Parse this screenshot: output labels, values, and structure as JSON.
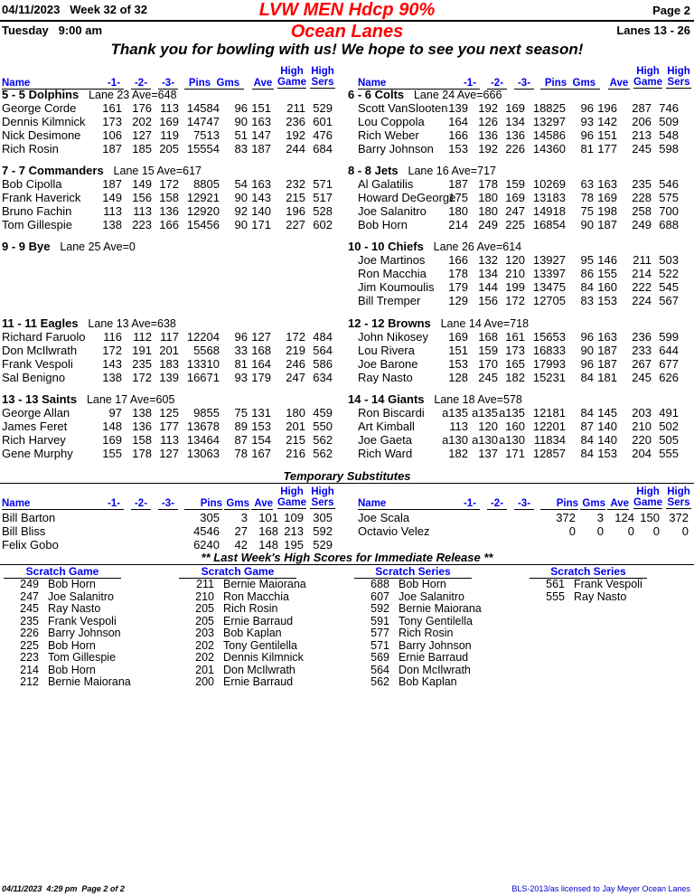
{
  "header": {
    "date": "04/11/2023",
    "week": "Week 32 of 32",
    "title": "LVW MEN Hdcp 90%",
    "page": "Page 2",
    "day_time": "Tuesday   9:00 am",
    "center": "Ocean Lanes",
    "lanes": "Lanes 13 - 26",
    "message": "Thank you for bowling with us! We hope to see you next season!"
  },
  "columns": {
    "name": "Name",
    "g1": "-1-",
    "g2": "-2-",
    "g3": "-3-",
    "pins": "Pins",
    "gms": "Gms",
    "ave": "Ave",
    "high_game_1": "High",
    "high_game_2": "Game",
    "high_sers_1": "High",
    "high_sers_2": "Sers"
  },
  "left_teams": [
    {
      "title": "5 - 5 Dolphins",
      "meta": "Lane 23  Ave=648",
      "players": [
        {
          "name": "George Corde",
          "g1": "161",
          "g2": "176",
          "g3": "113",
          "pins": "14584",
          "gms": "96",
          "ave": "151",
          "hg": "211",
          "hs": "529"
        },
        {
          "name": "Dennis Kilmnick",
          "g1": "173",
          "g2": "202",
          "g3": "169",
          "pins": "14747",
          "gms": "90",
          "ave": "163",
          "hg": "236",
          "hs": "601"
        },
        {
          "name": "Nick Desimone",
          "g1": "106",
          "g2": "127",
          "g3": "119",
          "pins": "7513",
          "gms": "51",
          "ave": "147",
          "hg": "192",
          "hs": "476"
        },
        {
          "name": "Rich Rosin",
          "g1": "187",
          "g2": "185",
          "g3": "205",
          "pins": "15554",
          "gms": "83",
          "ave": "187",
          "hg": "244",
          "hs": "684"
        }
      ]
    },
    {
      "title": "7 - 7 Commanders",
      "meta": "Lane 15  Ave=617",
      "players": [
        {
          "name": "Bob Cipolla",
          "g1": "187",
          "g2": "149",
          "g3": "172",
          "pins": "8805",
          "gms": "54",
          "ave": "163",
          "hg": "232",
          "hs": "571"
        },
        {
          "name": "Frank Haverick",
          "g1": "149",
          "g2": "156",
          "g3": "158",
          "pins": "12921",
          "gms": "90",
          "ave": "143",
          "hg": "215",
          "hs": "517"
        },
        {
          "name": "Bruno Fachin",
          "g1": "113",
          "g2": "113",
          "g3": "136",
          "pins": "12920",
          "gms": "92",
          "ave": "140",
          "hg": "196",
          "hs": "528"
        },
        {
          "name": "Tom Gillespie",
          "g1": "138",
          "g2": "223",
          "g3": "166",
          "pins": "15456",
          "gms": "90",
          "ave": "171",
          "hg": "227",
          "hs": "602"
        }
      ]
    },
    {
      "title": "9 - 9 Bye",
      "meta": "Lane 25  Ave=0",
      "players": []
    },
    {
      "title": "11 - 11 Eagles",
      "meta": "Lane 13  Ave=638",
      "players": [
        {
          "name": "Richard Faruolo",
          "g1": "116",
          "g2": "112",
          "g3": "117",
          "pins": "12204",
          "gms": "96",
          "ave": "127",
          "hg": "172",
          "hs": "484"
        },
        {
          "name": "Don McIlwrath",
          "g1": "172",
          "g2": "191",
          "g3": "201",
          "pins": "5568",
          "gms": "33",
          "ave": "168",
          "hg": "219",
          "hs": "564"
        },
        {
          "name": "Frank Vespoli",
          "g1": "143",
          "g2": "235",
          "g3": "183",
          "pins": "13310",
          "gms": "81",
          "ave": "164",
          "hg": "246",
          "hs": "586"
        },
        {
          "name": "Sal Benigno",
          "g1": "138",
          "g2": "172",
          "g3": "139",
          "pins": "16671",
          "gms": "93",
          "ave": "179",
          "hg": "247",
          "hs": "634"
        }
      ]
    },
    {
      "title": "13 - 13 Saints",
      "meta": "Lane 17  Ave=605",
      "players": [
        {
          "name": "George Allan",
          "g1": "97",
          "g2": "138",
          "g3": "125",
          "pins": "9855",
          "gms": "75",
          "ave": "131",
          "hg": "180",
          "hs": "459"
        },
        {
          "name": "James Feret",
          "g1": "148",
          "g2": "136",
          "g3": "177",
          "pins": "13678",
          "gms": "89",
          "ave": "153",
          "hg": "201",
          "hs": "550"
        },
        {
          "name": "Rich Harvey",
          "g1": "169",
          "g2": "158",
          "g3": "113",
          "pins": "13464",
          "gms": "87",
          "ave": "154",
          "hg": "215",
          "hs": "562"
        },
        {
          "name": "Gene Murphy",
          "g1": "155",
          "g2": "178",
          "g3": "127",
          "pins": "13063",
          "gms": "78",
          "ave": "167",
          "hg": "216",
          "hs": "562"
        }
      ]
    }
  ],
  "right_teams": [
    {
      "title": "6 - 6 Colts",
      "meta": "Lane 24  Ave=666",
      "players": [
        {
          "name": "Scott VanSlooten",
          "g1": "139",
          "g2": "192",
          "g3": "169",
          "pins": "18825",
          "gms": "96",
          "ave": "196",
          "hg": "287",
          "hs": "746"
        },
        {
          "name": "Lou Coppola",
          "g1": "164",
          "g2": "126",
          "g3": "134",
          "pins": "13297",
          "gms": "93",
          "ave": "142",
          "hg": "206",
          "hs": "509"
        },
        {
          "name": "Rich Weber",
          "g1": "166",
          "g2": "136",
          "g3": "136",
          "pins": "14586",
          "gms": "96",
          "ave": "151",
          "hg": "213",
          "hs": "548"
        },
        {
          "name": "Barry Johnson",
          "g1": "153",
          "g2": "192",
          "g3": "226",
          "pins": "14360",
          "gms": "81",
          "ave": "177",
          "hg": "245",
          "hs": "598"
        }
      ]
    },
    {
      "title": "8 - 8 Jets",
      "meta": "Lane 16  Ave=717",
      "players": [
        {
          "name": "Al Galatilis",
          "g1": "187",
          "g2": "178",
          "g3": "159",
          "pins": "10269",
          "gms": "63",
          "ave": "163",
          "hg": "235",
          "hs": "546"
        },
        {
          "name": "Howard DeGeorge",
          "g1": "175",
          "g2": "180",
          "g3": "169",
          "pins": "13183",
          "gms": "78",
          "ave": "169",
          "hg": "228",
          "hs": "575"
        },
        {
          "name": "Joe Salanitro",
          "g1": "180",
          "g2": "180",
          "g3": "247",
          "pins": "14918",
          "gms": "75",
          "ave": "198",
          "hg": "258",
          "hs": "700"
        },
        {
          "name": "Bob Horn",
          "g1": "214",
          "g2": "249",
          "g3": "225",
          "pins": "16854",
          "gms": "90",
          "ave": "187",
          "hg": "249",
          "hs": "688"
        }
      ]
    },
    {
      "title": "10 - 10 Chiefs",
      "meta": "Lane 26  Ave=614",
      "players": [
        {
          "name": "Joe Martinos",
          "g1": "166",
          "g2": "132",
          "g3": "120",
          "pins": "13927",
          "gms": "95",
          "ave": "146",
          "hg": "211",
          "hs": "503"
        },
        {
          "name": "Ron Macchia",
          "g1": "178",
          "g2": "134",
          "g3": "210",
          "pins": "13397",
          "gms": "86",
          "ave": "155",
          "hg": "214",
          "hs": "522"
        },
        {
          "name": "Jim Koumoulis",
          "g1": "179",
          "g2": "144",
          "g3": "199",
          "pins": "13475",
          "gms": "84",
          "ave": "160",
          "hg": "222",
          "hs": "545"
        },
        {
          "name": "Bill Tremper",
          "g1": "129",
          "g2": "156",
          "g3": "172",
          "pins": "12705",
          "gms": "83",
          "ave": "153",
          "hg": "224",
          "hs": "567"
        }
      ]
    },
    {
      "title": "12 - 12 Browns",
      "meta": "Lane 14  Ave=718",
      "players": [
        {
          "name": "John Nikosey",
          "g1": "169",
          "g2": "168",
          "g3": "161",
          "pins": "15653",
          "gms": "96",
          "ave": "163",
          "hg": "236",
          "hs": "599"
        },
        {
          "name": "Lou Rivera",
          "g1": "151",
          "g2": "159",
          "g3": "173",
          "pins": "16833",
          "gms": "90",
          "ave": "187",
          "hg": "233",
          "hs": "644"
        },
        {
          "name": "Joe Barone",
          "g1": "153",
          "g2": "170",
          "g3": "165",
          "pins": "17993",
          "gms": "96",
          "ave": "187",
          "hg": "267",
          "hs": "677"
        },
        {
          "name": "Ray Nasto",
          "g1": "128",
          "g2": "245",
          "g3": "182",
          "pins": "15231",
          "gms": "84",
          "ave": "181",
          "hg": "245",
          "hs": "626"
        }
      ]
    },
    {
      "title": "14 - 14 Giants",
      "meta": "Lane 18  Ave=578",
      "players": [
        {
          "name": "Ron Biscardi",
          "g1": "a135",
          "g2": "a135",
          "g3": "a135",
          "pins": "12181",
          "gms": "84",
          "ave": "145",
          "hg": "203",
          "hs": "491"
        },
        {
          "name": "Art Kimball",
          "g1": "113",
          "g2": "120",
          "g3": "160",
          "pins": "12201",
          "gms": "87",
          "ave": "140",
          "hg": "210",
          "hs": "502"
        },
        {
          "name": "Joe Gaeta",
          "g1": "a130",
          "g2": "a130",
          "g3": "a130",
          "pins": "11834",
          "gms": "84",
          "ave": "140",
          "hg": "220",
          "hs": "505"
        },
        {
          "name": "Rich Ward",
          "g1": "182",
          "g2": "137",
          "g3": "171",
          "pins": "12857",
          "gms": "84",
          "ave": "153",
          "hg": "204",
          "hs": "555"
        }
      ]
    }
  ],
  "substitutes": {
    "title": "Temporary Substitutes",
    "left": [
      {
        "name": "Bill Barton",
        "pins": "305",
        "gms": "3",
        "ave": "101",
        "hg": "109",
        "hs": "305"
      },
      {
        "name": "Bill Bliss",
        "pins": "4546",
        "gms": "27",
        "ave": "168",
        "hg": "213",
        "hs": "592"
      },
      {
        "name": "Felix Gobo",
        "pins": "6240",
        "gms": "42",
        "ave": "148",
        "hg": "195",
        "hs": "529"
      }
    ],
    "right": [
      {
        "name": "Joe Scala",
        "pins": "372",
        "gms": "3",
        "ave": "124",
        "hg": "150",
        "hs": "372"
      },
      {
        "name": "Octavio Velez",
        "pins": "0",
        "gms": "0",
        "ave": "0",
        "hg": "0",
        "hs": "0"
      }
    ]
  },
  "high_scores": {
    "title": "** Last Week's High Scores for Immediate Release **",
    "columns": [
      {
        "heading": "Scratch Game",
        "entries": [
          {
            "score": "249",
            "name": "Bob Horn"
          },
          {
            "score": "247",
            "name": "Joe Salanitro"
          },
          {
            "score": "245",
            "name": "Ray Nasto"
          },
          {
            "score": "235",
            "name": "Frank Vespoli"
          },
          {
            "score": "226",
            "name": "Barry Johnson"
          },
          {
            "score": "225",
            "name": "Bob Horn"
          },
          {
            "score": "223",
            "name": "Tom Gillespie"
          },
          {
            "score": "214",
            "name": "Bob Horn"
          },
          {
            "score": "212",
            "name": "Bernie Maiorana"
          }
        ]
      },
      {
        "heading": "Scratch Game",
        "entries": [
          {
            "score": "211",
            "name": "Bernie Maiorana"
          },
          {
            "score": "210",
            "name": "Ron Macchia"
          },
          {
            "score": "205",
            "name": "Rich Rosin"
          },
          {
            "score": "205",
            "name": "Ernie Barraud"
          },
          {
            "score": "203",
            "name": "Bob Kaplan"
          },
          {
            "score": "202",
            "name": "Tony Gentilella"
          },
          {
            "score": "202",
            "name": "Dennis Kilmnick"
          },
          {
            "score": "201",
            "name": "Don McIlwrath"
          },
          {
            "score": "200",
            "name": "Ernie Barraud"
          }
        ]
      },
      {
        "heading": "Scratch Series",
        "entries": [
          {
            "score": "688",
            "name": "Bob Horn"
          },
          {
            "score": "607",
            "name": "Joe Salanitro"
          },
          {
            "score": "592",
            "name": "Bernie Maiorana"
          },
          {
            "score": "591",
            "name": "Tony Gentilella"
          },
          {
            "score": "577",
            "name": "Rich Rosin"
          },
          {
            "score": "571",
            "name": "Barry Johnson"
          },
          {
            "score": "569",
            "name": "Ernie Barraud"
          },
          {
            "score": "564",
            "name": "Don McIlwrath"
          },
          {
            "score": "562",
            "name": "Bob Kaplan"
          }
        ]
      },
      {
        "heading": "Scratch Series",
        "entries": [
          {
            "score": "561",
            "name": "Frank Vespoli"
          },
          {
            "score": "555",
            "name": "Ray Nasto"
          }
        ]
      }
    ]
  },
  "footer": {
    "left": "04/11/2023  4:29 pm  Page 2 of 2",
    "right": "BLS-2013/as licensed to Jay Meyer  Ocean Lanes"
  }
}
